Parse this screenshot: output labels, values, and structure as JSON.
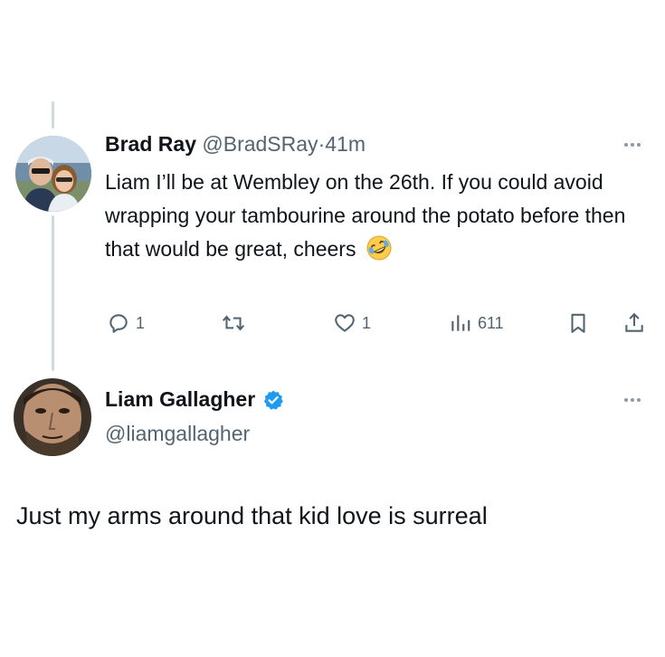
{
  "tweet": {
    "author_name": "Brad Ray",
    "handle": "@BradSRay",
    "separator": "·",
    "time": "41m",
    "body": "Liam I’ll be at Wembley on the 26th. If you could avoid wrapping your tambourine around the potato before then that would be great, cheers",
    "emoji": "rolling-on-the-floor-laughing",
    "actions": {
      "reply_count": "1",
      "like_count": "1",
      "views_count": "611"
    }
  },
  "reply_author": {
    "name": "Liam Gallagher",
    "handle": "@liamgallagher",
    "verified": true
  },
  "reply_text": "Just my arms around that kid love is surreal",
  "colors": {
    "text_primary": "#0f1419",
    "text_secondary": "#536471",
    "verified_blue": "#1d9bf0",
    "thread_line": "#cfd9de"
  }
}
